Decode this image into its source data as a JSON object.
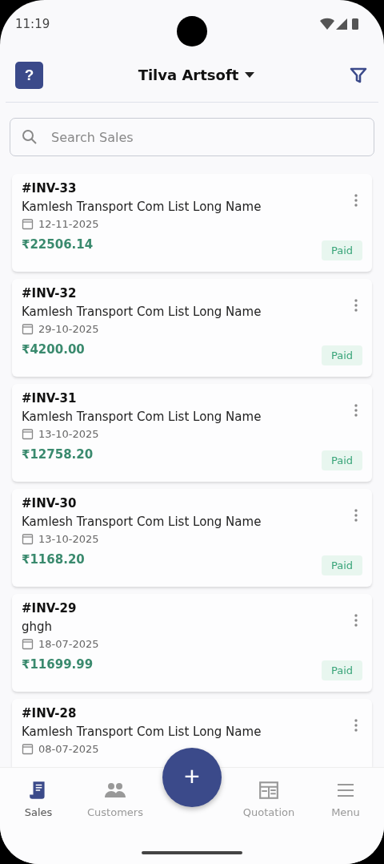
{
  "status_bar": {
    "time": "11:19"
  },
  "header": {
    "title": "Tilva Artsoft",
    "help_label": "?"
  },
  "search": {
    "placeholder": "Search Sales"
  },
  "invoices": [
    {
      "number": "#INV-33",
      "customer": "Kamlesh Transport Com List Long Name",
      "date": "12-11-2025",
      "amount": "₹22506.14",
      "status": "Paid",
      "kind": "paid"
    },
    {
      "number": "#INV-32",
      "customer": "Kamlesh Transport Com List Long Name",
      "date": "29-10-2025",
      "amount": "₹4200.00",
      "status": "Paid",
      "kind": "paid"
    },
    {
      "number": "#INV-31",
      "customer": "Kamlesh Transport Com List Long Name",
      "date": "13-10-2025",
      "amount": "₹12758.20",
      "status": "Paid",
      "kind": "paid"
    },
    {
      "number": "#INV-30",
      "customer": "Kamlesh Transport Com List Long Name",
      "date": "13-10-2025",
      "amount": "₹1168.20",
      "status": "Paid",
      "kind": "paid"
    },
    {
      "number": "#INV-29",
      "customer": "ghgh",
      "date": "18-07-2025",
      "amount": "₹11699.99",
      "status": "Paid",
      "kind": "paid"
    },
    {
      "number": "#INV-28",
      "customer": "Kamlesh Transport Com List Long Name",
      "date": "08-07-2025"
    }
  ],
  "fab": {
    "label": "+"
  },
  "nav": [
    {
      "label": "Sales",
      "kind": "sales",
      "selected": true
    },
    {
      "label": "Customers",
      "kind": "customers",
      "selected": false
    },
    {
      "label": "Quotation",
      "kind": "quotation",
      "selected": false
    },
    {
      "label": "Menu",
      "kind": "menu",
      "selected": false
    }
  ]
}
